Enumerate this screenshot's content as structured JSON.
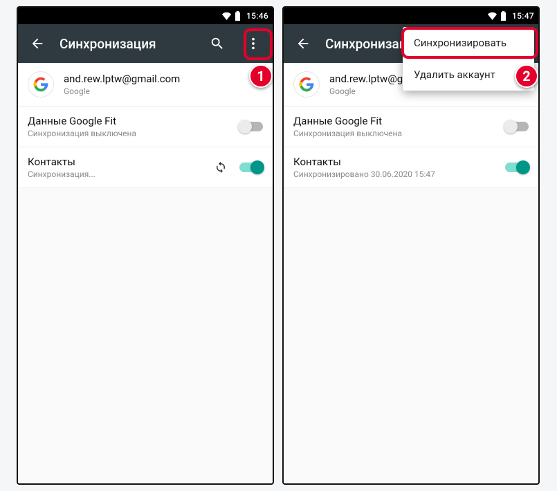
{
  "left": {
    "status_time": "15:46",
    "appbar_title": "Синхронизация",
    "account": {
      "email": "and.rew.lptw@gmail.com",
      "provider": "Google"
    },
    "rows": [
      {
        "title": "Данные Google Fit",
        "sub": "Синхронизация выключена",
        "on": false,
        "syncing": false
      },
      {
        "title": "Контакты",
        "sub": "Синхронизация...",
        "on": true,
        "syncing": true
      }
    ],
    "badge": "1"
  },
  "right": {
    "status_time": "15:47",
    "appbar_title": "Синхронизация",
    "account": {
      "email": "and.rew.lptw@gmail.com",
      "provider": "Google"
    },
    "rows": [
      {
        "title": "Данные Google Fit",
        "sub": "Синхронизация выключена",
        "on": false,
        "syncing": false
      },
      {
        "title": "Контакты",
        "sub": "Синхронизировано 30.06.2020 15:47",
        "on": true,
        "syncing": false
      }
    ],
    "menu": {
      "item1": "Синхронизировать",
      "item2": "Удалить аккаунт"
    },
    "badge": "2"
  }
}
